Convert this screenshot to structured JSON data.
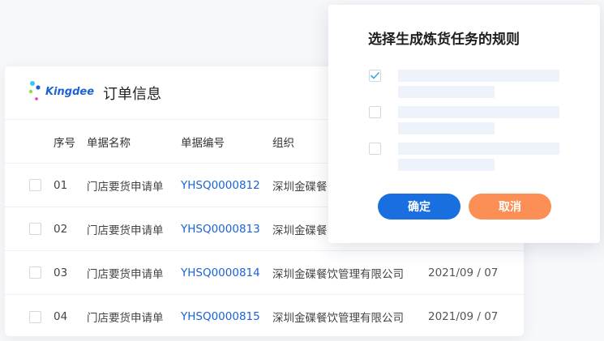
{
  "brand": {
    "name": "Kingdee"
  },
  "order": {
    "title": "订单信息",
    "columns": {
      "no": "序号",
      "name": "单据名称",
      "code": "单据编号",
      "org": "组织"
    },
    "rows": [
      {
        "no": "01",
        "name": "门店要货申请单",
        "code": "YHSQ0000812",
        "org": "深圳金碟餐",
        "date": ""
      },
      {
        "no": "02",
        "name": "门店要货申请单",
        "code": "YHSQ0000813",
        "org": "深圳金碟餐",
        "date": ""
      },
      {
        "no": "03",
        "name": "门店要货申请单",
        "code": "YHSQ0000814",
        "org": "深圳金碟餐饮管理有限公司",
        "date": "2021/09 / 07"
      },
      {
        "no": "04",
        "name": "门店要货申请单",
        "code": "YHSQ0000815",
        "org": "深圳金碟餐饮管理有限公司",
        "date": "2021/09 / 07"
      }
    ]
  },
  "dialog": {
    "title": "选择生成炼货任务的规则",
    "options": [
      {
        "checked": true
      },
      {
        "checked": false
      },
      {
        "checked": false
      }
    ],
    "confirm_label": "确定",
    "cancel_label": "取消"
  },
  "colors": {
    "link": "#1a63d8",
    "primary": "#1a6fe0",
    "cancel": "#fb8f55",
    "check": "#3aa8e8",
    "logo_dots": [
      "#3cc8f0",
      "#1e63d6",
      "#8fe03a",
      "#e03ab8"
    ]
  }
}
